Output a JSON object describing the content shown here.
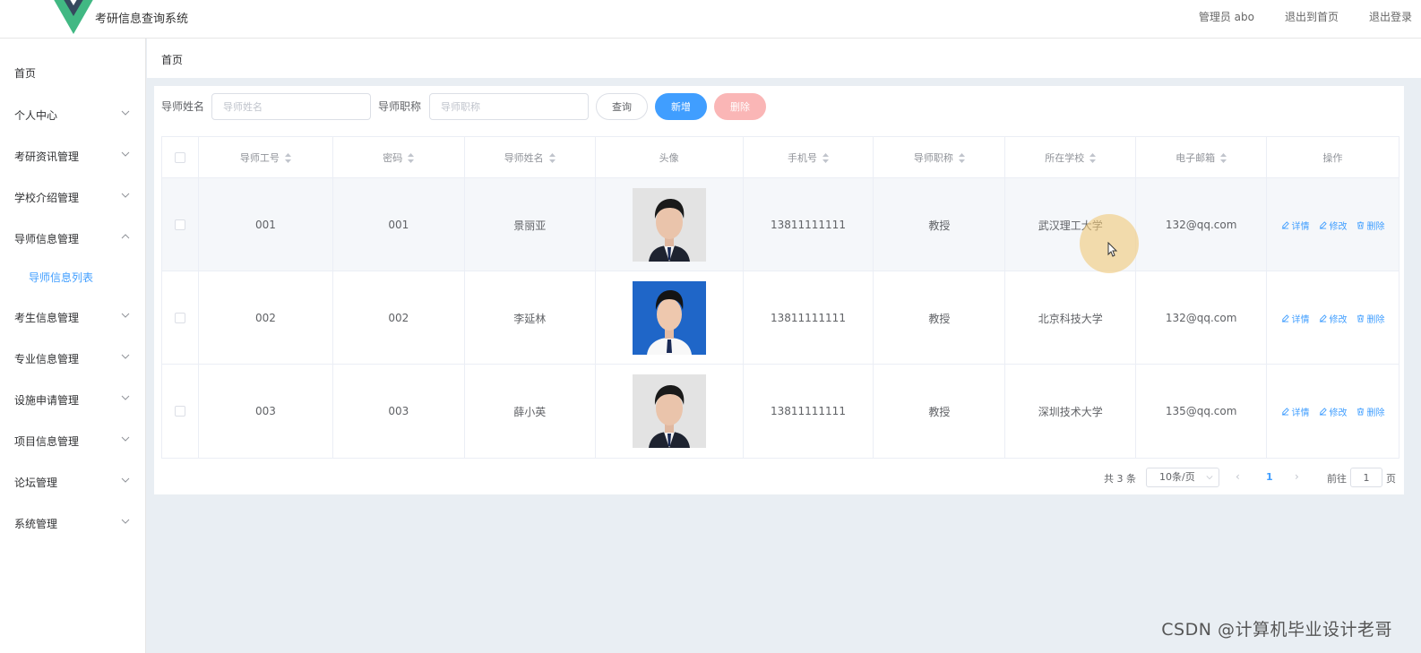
{
  "header": {
    "title": "考研信息查询系统",
    "admin": "管理员 abo",
    "back_home": "退出到首页",
    "logout": "退出登录",
    "logo_colors": {
      "outer": "#41b883",
      "inner": "#35495e"
    }
  },
  "sidebar": {
    "items": [
      {
        "label": "首页",
        "chevron": ""
      },
      {
        "label": "个人中心",
        "chevron": "down"
      },
      {
        "label": "考研资讯管理",
        "chevron": "down"
      },
      {
        "label": "学校介绍管理",
        "chevron": "down"
      },
      {
        "label": "导师信息管理",
        "chevron": "up"
      },
      {
        "label": "考生信息管理",
        "chevron": "down"
      },
      {
        "label": "专业信息管理",
        "chevron": "down"
      },
      {
        "label": "设施申请管理",
        "chevron": "down"
      },
      {
        "label": "项目信息管理",
        "chevron": "down"
      },
      {
        "label": "论坛管理",
        "chevron": "down"
      },
      {
        "label": "系统管理",
        "chevron": "down"
      }
    ],
    "active_sub": "导师信息列表"
  },
  "breadcrumb": {
    "current": "首页"
  },
  "search": {
    "name_label": "导师姓名",
    "name_placeholder": "导师姓名",
    "title_label": "导师职称",
    "title_placeholder": "导师职称",
    "query_btn": "查询",
    "add_btn": "新增",
    "delete_btn": "删除"
  },
  "table": {
    "columns": [
      "导师工号",
      "密码",
      "导师姓名",
      "头像",
      "手机号",
      "导师职称",
      "所在学校",
      "电子邮箱",
      "操作"
    ],
    "sortable": [
      true,
      true,
      true,
      false,
      true,
      true,
      true,
      true,
      false
    ],
    "rows": [
      {
        "id": "001",
        "password": "001",
        "name": "景丽亚",
        "avatar_bg": "#e3e3e3",
        "phone": "13811111111",
        "title": "教授",
        "school": "武汉理工大学",
        "email": "132@qq.com"
      },
      {
        "id": "002",
        "password": "002",
        "name": "李延林",
        "avatar_bg": "#1f66c8",
        "phone": "13811111111",
        "title": "教授",
        "school": "北京科技大学",
        "email": "132@qq.com"
      },
      {
        "id": "003",
        "password": "003",
        "name": "薛小英",
        "avatar_bg": "#e3e3e3",
        "phone": "13811111111",
        "title": "教授",
        "school": "深圳技术大学",
        "email": "135@qq.com"
      }
    ],
    "ops": {
      "detail": "详情",
      "edit": "修改",
      "delete": "删除"
    }
  },
  "pagination": {
    "total": "共 3 条",
    "page_size": "10条/页",
    "current": "1",
    "goto": "前往",
    "goto_value": "1",
    "page_suffix": "页"
  },
  "watermark": "CSDN @计算机毕业设计老哥"
}
